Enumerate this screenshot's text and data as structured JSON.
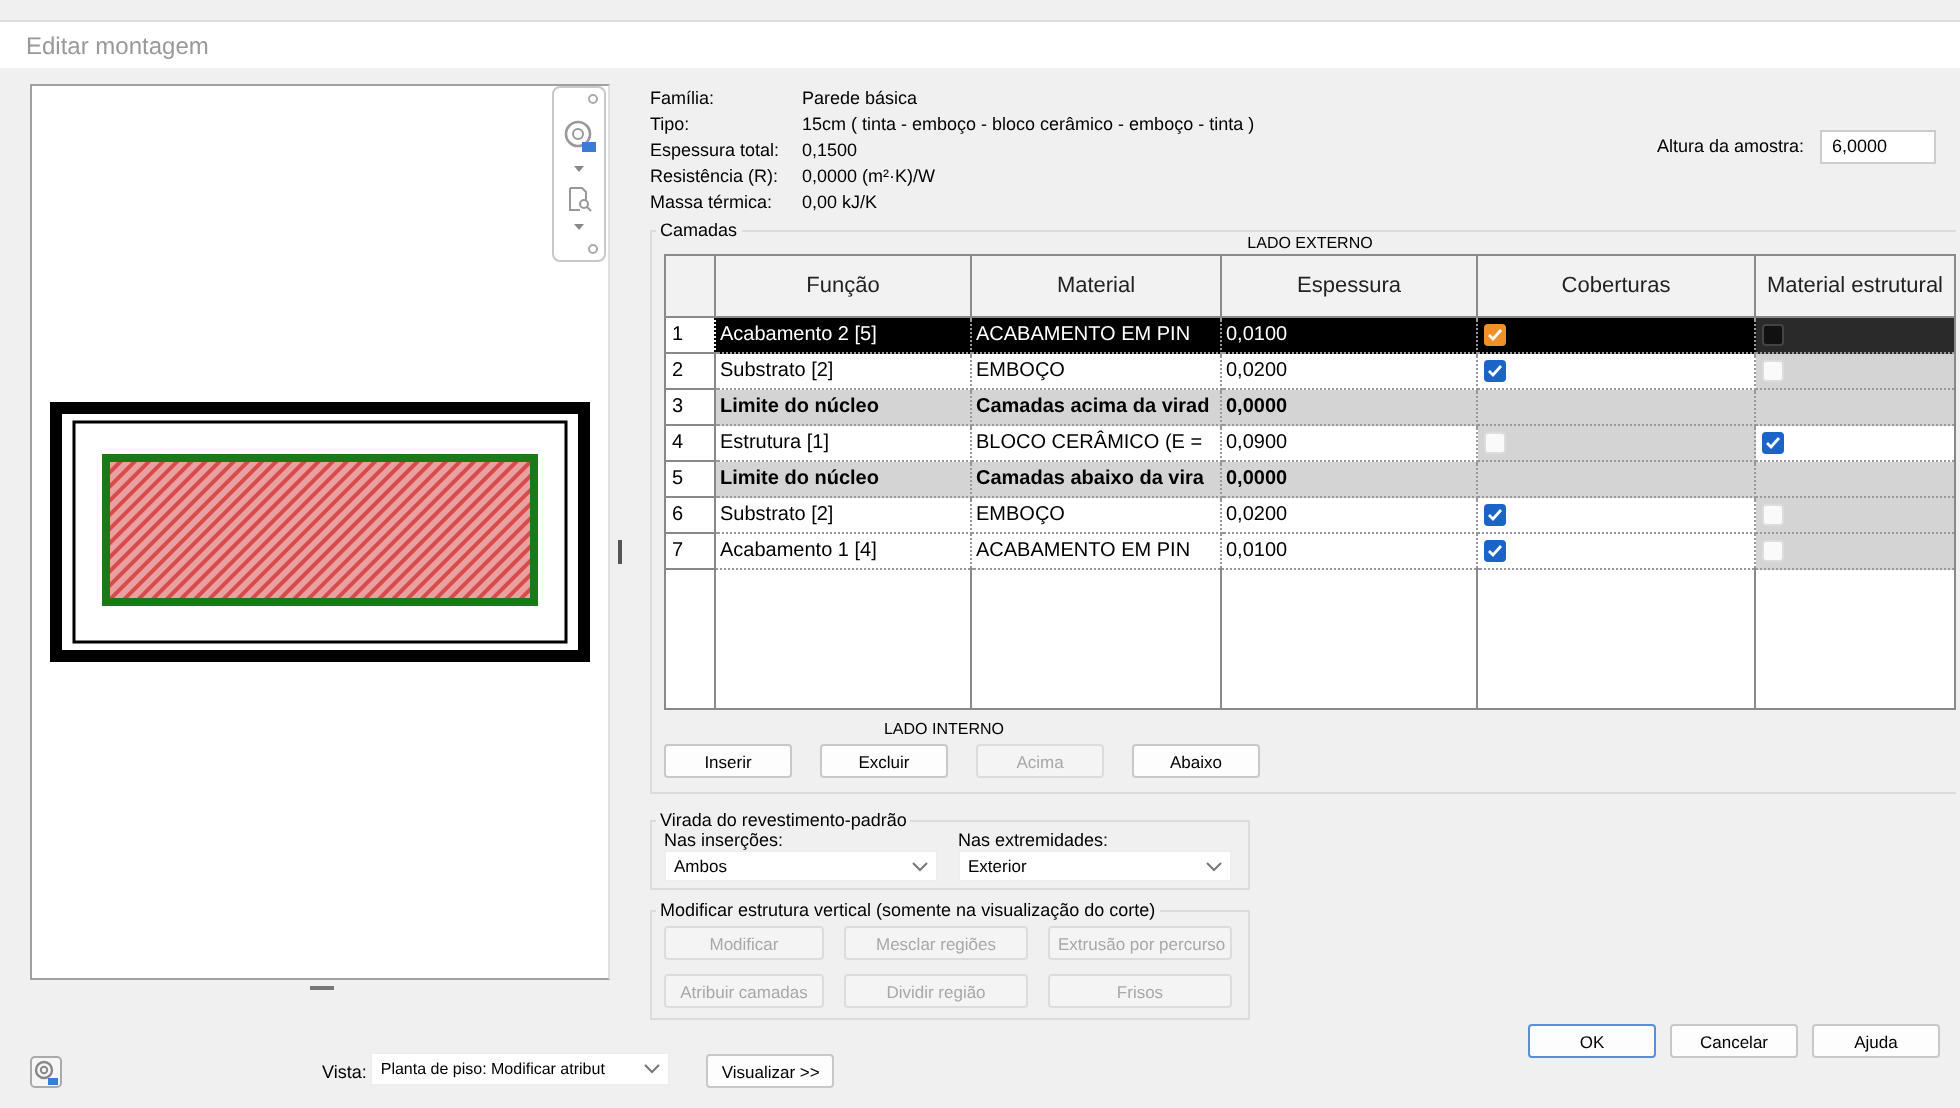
{
  "window": {
    "title": "Editar montagem"
  },
  "properties": [
    {
      "label": "Família:",
      "value": "Parede básica"
    },
    {
      "label": "Tipo:",
      "value": "15cm  ( tinta - emboço - bloco cerâmico - emboço - tinta )"
    },
    {
      "label": "Espessura total:",
      "value": "0,1500"
    },
    {
      "label": "Resistência (R):",
      "value": "0,0000 (m²·K)/W"
    },
    {
      "label": "Massa térmica:",
      "value": "0,00 kJ/K"
    }
  ],
  "sample_height": {
    "label": "Altura da amostra:",
    "value": "6,0000"
  },
  "layers": {
    "title": "Camadas",
    "exterior_label": "LADO EXTERNO",
    "interior_label": "LADO INTERNO",
    "columns": [
      "Função",
      "Material",
      "Espessura",
      "Coberturas",
      "Material estrutural"
    ],
    "rows": [
      {
        "number": "1",
        "kind": "layer",
        "selected": true,
        "function": "Acabamento 2 [5]",
        "material": "ACABAMENTO EM PIN",
        "thickness": "0,0100",
        "wraps": {
          "checked": true,
          "disabled": false
        },
        "structural": {
          "checked": false,
          "disabled": false
        }
      },
      {
        "number": "2",
        "kind": "layer",
        "selected": false,
        "function": "Substrato [2]",
        "material": "EMBOÇO",
        "thickness": "0,0200",
        "wraps": {
          "checked": true,
          "disabled": false
        },
        "structural": {
          "checked": false,
          "disabled": true
        }
      },
      {
        "number": "3",
        "kind": "boundary",
        "selected": false,
        "function": "Limite do núcleo",
        "material": "Camadas acima da virad",
        "thickness": "0,0000"
      },
      {
        "number": "4",
        "kind": "layer",
        "selected": false,
        "function": "Estrutura [1]",
        "material": "BLOCO CERÂMICO (E =",
        "thickness": "0,0900",
        "wraps": {
          "checked": false,
          "disabled": true
        },
        "structural": {
          "checked": true,
          "disabled": false
        }
      },
      {
        "number": "5",
        "kind": "boundary",
        "selected": false,
        "function": "Limite do núcleo",
        "material": "Camadas abaixo da vira",
        "thickness": "0,0000"
      },
      {
        "number": "6",
        "kind": "layer",
        "selected": false,
        "function": "Substrato [2]",
        "material": "EMBOÇO",
        "thickness": "0,0200",
        "wraps": {
          "checked": true,
          "disabled": false
        },
        "structural": {
          "checked": false,
          "disabled": true
        }
      },
      {
        "number": "7",
        "kind": "layer",
        "selected": false,
        "function": "Acabamento 1 [4]",
        "material": "ACABAMENTO EM PIN",
        "thickness": "0,0100",
        "wraps": {
          "checked": true,
          "disabled": false
        },
        "structural": {
          "checked": false,
          "disabled": true
        }
      }
    ],
    "buttons": [
      {
        "label": "Inserir",
        "disabled": false
      },
      {
        "label": "Excluir",
        "disabled": false
      },
      {
        "label": "Acima",
        "disabled": true
      },
      {
        "label": "Abaixo",
        "disabled": false
      }
    ]
  },
  "wrapping": {
    "title": "Virada do revestimento-padrão",
    "fields": [
      {
        "label": "Nas inserções:",
        "value": "Ambos"
      },
      {
        "label": "Nas extremidades:",
        "value": "Exterior"
      }
    ]
  },
  "vertical_structure": {
    "title": "Modificar estrutura vertical (somente na visualização do corte)",
    "buttons": [
      {
        "label": "Modificar",
        "disabled": true
      },
      {
        "label": "Mesclar regiões",
        "disabled": true
      },
      {
        "label": "Extrusão por percurso",
        "disabled": true
      },
      {
        "label": "Atribuir camadas",
        "disabled": true
      },
      {
        "label": "Dividir região",
        "disabled": true
      },
      {
        "label": "Frisos",
        "disabled": true
      }
    ]
  },
  "view": {
    "label": "Vista:",
    "value": "Planta de piso: Modificar atribut"
  },
  "preview_button": "Visualizar >>",
  "dialog_buttons": [
    {
      "label": "OK",
      "default": true
    },
    {
      "label": "Cancelar",
      "default": false
    },
    {
      "label": "Ajuda",
      "default": false
    }
  ]
}
